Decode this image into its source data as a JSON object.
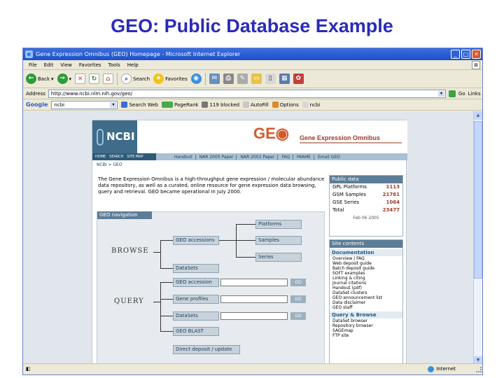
{
  "slide": {
    "title": "GEO: Public Database Example"
  },
  "browser": {
    "title": "Gene Expression Omnibus (GEO) Homepage - Microsoft Internet Explorer",
    "menu": [
      "File",
      "Edit",
      "View",
      "Favorites",
      "Tools",
      "Help"
    ],
    "toolbar": {
      "back": "Back",
      "search": "Search",
      "favorites": "Favorites"
    },
    "address": {
      "label": "Address",
      "url": "http://www.ncbi.nlm.nih.gov/geo/",
      "go": "Go",
      "links": "Links"
    },
    "google": {
      "label": "Google",
      "query": "ncbi",
      "search_web": "Search Web",
      "pagerank": "PageRank",
      "blocked": "119 blocked",
      "autofill": "AutoFill",
      "options": "Options",
      "ncbi": "ncbi"
    },
    "status": {
      "zone": "Internet"
    }
  },
  "geo_page": {
    "ncbi_logo": "NCBI",
    "geo_logo": "GE",
    "tagline": "Gene Expression Omnibus",
    "ncbi_nav": [
      "HOME",
      "SEARCH",
      "SITE MAP"
    ],
    "top_links": [
      "Handout",
      "NAR 2005 Paper",
      "NAR 2002 Paper",
      "FAQ",
      "MIAME",
      "Email GEO"
    ],
    "breadcrumb": "NCBI > GEO",
    "intro": "The Gene Expression Omnibus is a high-throughput gene expression / molecular abundance data repository, as well as a curated, online resource for gene expression data browsing, query and retrieval. GEO became operational in July 2000.",
    "public_data": {
      "header": "Public data",
      "rows": [
        {
          "label": "GPL Platforms",
          "value": "1113"
        },
        {
          "label": "GSM Samples",
          "value": "21761"
        },
        {
          "label": "GSE Series",
          "value": "1064"
        },
        {
          "label": "Total",
          "value": "23477"
        }
      ],
      "date": "Feb 06 2005"
    },
    "geo_navigation": {
      "tab": "GEO navigation",
      "browse_label": "BROWSE",
      "query_label": "QUERY",
      "browse_btns": [
        "GEO accessions",
        "DataSets"
      ],
      "browse_right": [
        "Platforms",
        "Samples",
        "Series"
      ],
      "query_btns": [
        "GEO accession",
        "Gene profiles",
        "DataSets",
        "GEO BLAST"
      ],
      "go": "GO",
      "deposit": "Direct deposit / update"
    },
    "site_contents": {
      "header": "Site contents",
      "doc_header": "Documentation",
      "docs": [
        "Overview | FAQ",
        "Web deposit guide",
        "Batch deposit guide",
        "SOFT examples",
        "Linking & citing",
        "Journal citations",
        "Handout (pdf)",
        "DataSet clusters",
        "GEO announcement list",
        "Data disclaimer",
        "GEO staff"
      ],
      "query_header": "Query & Browse",
      "query_items": [
        "DataSet browser",
        "Repository browser",
        "SAGEmap",
        "FTP site"
      ]
    }
  }
}
